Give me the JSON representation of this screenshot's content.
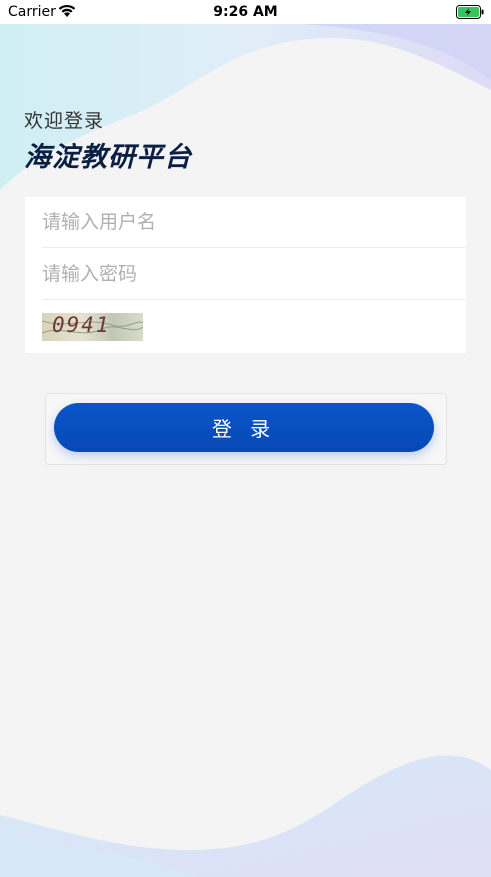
{
  "status_bar": {
    "carrier": "Carrier",
    "time": "9:26 AM"
  },
  "header": {
    "welcome": "欢迎登录",
    "platform_name": "海淀教研平台"
  },
  "form": {
    "username_placeholder": "请输入用户名",
    "password_placeholder": "请输入密码",
    "captcha_text": "0941"
  },
  "login_button": "登 录",
  "colors": {
    "accent": "#0a55c9",
    "title": "#0a1f44",
    "background": "#f4f4f5"
  }
}
